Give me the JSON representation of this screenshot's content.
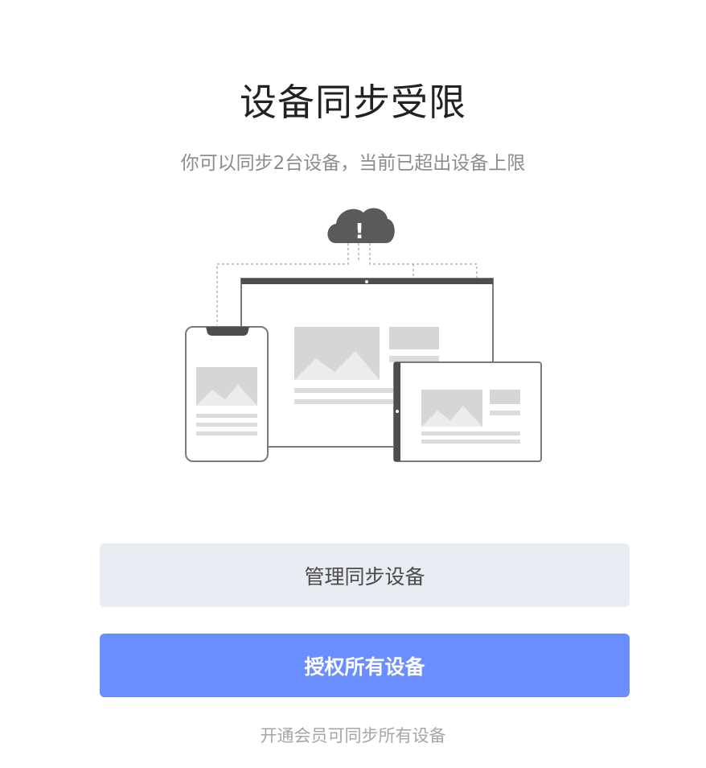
{
  "dialog": {
    "title": "设备同步受限",
    "subtitle": "你可以同步2台设备，当前已超出设备上限",
    "illustration": {
      "cloud_icon": "cloud-warning-icon",
      "cloud_mark": "!",
      "devices": [
        "phone-icon",
        "desktop-monitor-icon",
        "tablet-icon"
      ]
    },
    "buttons": {
      "manage_label": "管理同步设备",
      "authorize_label": "授权所有设备"
    },
    "vip_hint": "开通会员可同步所有设备",
    "colors": {
      "primary": "#6a8dff",
      "secondary_bg": "#e9ecf2",
      "title_text": "#222222",
      "muted_text": "#8c8c8c"
    }
  }
}
